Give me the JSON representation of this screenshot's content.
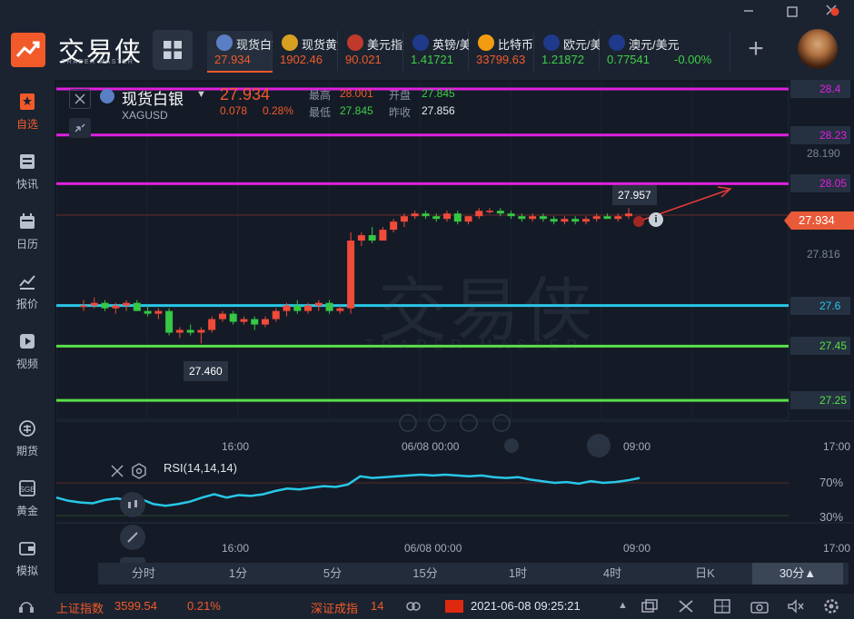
{
  "app": {
    "logo_text": "交易侠",
    "logo_sub": "TRADER MASTER"
  },
  "tickers": [
    {
      "name": "现货白银",
      "price": "27.934",
      "color": "#f25a2a",
      "icon": "silver-coin-icon",
      "icon_bg": "#5b7fc4"
    },
    {
      "name": "现货黄金",
      "price": "1902.46",
      "color": "#f25a2a",
      "icon": "gold-coin-icon",
      "icon_bg": "#d8a020"
    },
    {
      "name": "美元指数",
      "price": "90.021",
      "color": "#f25a2a",
      "icon": "us-flag-icon",
      "icon_bg": "#c0392b"
    },
    {
      "name": "英镑/美元",
      "price": "1.41721",
      "color": "#3ed048",
      "icon": "uk-flag-icon",
      "icon_bg": "#1f3a8a"
    },
    {
      "name": "比特币",
      "price": "33799.63",
      "color": "#f25a2a",
      "icon": "bitcoin-icon",
      "icon_bg": "#f39c12"
    },
    {
      "name": "欧元/美元",
      "price": "1.21872",
      "color": "#3ed048",
      "icon": "eu-flag-icon",
      "icon_bg": "#1f3a8a"
    },
    {
      "name": "澳元/美元",
      "price": "0.77541",
      "change": "-0.00%",
      "color": "#3ed048",
      "icon": "au-flag-icon",
      "icon_bg": "#1f3a8a"
    }
  ],
  "sidebar": [
    {
      "label": "自选",
      "icon": "bookmark-icon",
      "active": true
    },
    {
      "label": "快讯",
      "icon": "news-icon"
    },
    {
      "label": "日历",
      "icon": "calendar-icon"
    },
    {
      "label": "报价",
      "icon": "quote-chart-icon"
    },
    {
      "label": "视频",
      "icon": "video-play-icon"
    },
    {
      "label": "期货",
      "icon": "futures-icon"
    },
    {
      "label": "黄金",
      "icon": "sge-gold-icon"
    },
    {
      "label": "模拟",
      "icon": "simulate-wallet-icon"
    }
  ],
  "symbol": {
    "name": "现货白银",
    "code": "XAGUSD",
    "price": "27.934",
    "change": "0.078",
    "change_pct": "0.28%",
    "high_label": "最高",
    "high": "28.001",
    "open_label": "开盘",
    "open": "27.845",
    "low_label": "最低",
    "low": "27.845",
    "prev_label": "昨收",
    "prev": "27.856"
  },
  "watermark": {
    "text": "交易侠",
    "sub": "TRADER MASTER"
  },
  "levels": [
    {
      "value": 28.4,
      "label": "28.4",
      "color": "#e020e0"
    },
    {
      "value": 28.23,
      "label": "28.23",
      "color": "#e020e0"
    },
    {
      "value": 28.05,
      "label": "28.05",
      "color": "#e020e0"
    },
    {
      "value": 27.6,
      "label": "27.6",
      "color": "#28c8e8"
    },
    {
      "value": 27.45,
      "label": "27.45",
      "color": "#58e048"
    },
    {
      "value": 27.25,
      "label": "27.25",
      "color": "#58e048"
    }
  ],
  "axis_labels": {
    "p28190": "28.190",
    "p27816": "27.816",
    "current": "27.934",
    "hi_callout": "27.957",
    "lo_callout": "27.460"
  },
  "time_axis": {
    "t1": "16:00",
    "t2": "06/08 00:00",
    "t3": "09:00",
    "t4": "17:00"
  },
  "rsi": {
    "label": "RSI(14,14,14)",
    "upper": "70%",
    "lower": "30%"
  },
  "timeframes": [
    {
      "label": "分时"
    },
    {
      "label": "1分"
    },
    {
      "label": "5分"
    },
    {
      "label": "15分"
    },
    {
      "label": "1时"
    },
    {
      "label": "4时"
    },
    {
      "label": "日K"
    },
    {
      "label": "30分▲",
      "selected": true
    }
  ],
  "status": {
    "idx1_name": "上证指数",
    "idx1_value": "3599.54",
    "idx1_pct": "0.21%",
    "idx2_name": "深证成指",
    "idx2_value": "14",
    "datetime": "2021-06-08 09:25:21"
  },
  "chart_data": {
    "type": "candlestick",
    "interval": "30分",
    "ohlc": [
      [
        27.6,
        27.62,
        27.58,
        27.6
      ],
      [
        27.6,
        27.63,
        27.59,
        27.61
      ],
      [
        27.61,
        27.62,
        27.58,
        27.59
      ],
      [
        27.59,
        27.61,
        27.57,
        27.6
      ],
      [
        27.6,
        27.62,
        27.58,
        27.61
      ],
      [
        27.61,
        27.62,
        27.58,
        27.58
      ],
      [
        27.58,
        27.6,
        27.56,
        27.57
      ],
      [
        27.57,
        27.59,
        27.55,
        27.58
      ],
      [
        27.58,
        27.59,
        27.49,
        27.5
      ],
      [
        27.5,
        27.52,
        27.48,
        27.51
      ],
      [
        27.51,
        27.53,
        27.49,
        27.5
      ],
      [
        27.5,
        27.52,
        27.46,
        27.51
      ],
      [
        27.51,
        27.56,
        27.5,
        27.55
      ],
      [
        27.55,
        27.58,
        27.54,
        27.57
      ],
      [
        27.57,
        27.58,
        27.53,
        27.54
      ],
      [
        27.54,
        27.56,
        27.53,
        27.55
      ],
      [
        27.55,
        27.56,
        27.51,
        27.53
      ],
      [
        27.53,
        27.56,
        27.52,
        27.55
      ],
      [
        27.55,
        27.59,
        27.54,
        27.58
      ],
      [
        27.58,
        27.61,
        27.56,
        27.6
      ],
      [
        27.6,
        27.62,
        27.57,
        27.58
      ],
      [
        27.58,
        27.61,
        27.57,
        27.6
      ],
      [
        27.6,
        27.62,
        27.58,
        27.61
      ],
      [
        27.61,
        27.62,
        27.57,
        27.58
      ],
      [
        27.58,
        27.6,
        27.57,
        27.59
      ],
      [
        27.59,
        27.87,
        27.57,
        27.84
      ],
      [
        27.84,
        27.87,
        27.82,
        27.86
      ],
      [
        27.86,
        27.89,
        27.83,
        27.84
      ],
      [
        27.84,
        27.89,
        27.84,
        27.88
      ],
      [
        27.88,
        27.92,
        27.87,
        27.91
      ],
      [
        27.91,
        27.94,
        27.89,
        27.93
      ],
      [
        27.93,
        27.95,
        27.92,
        27.94
      ],
      [
        27.94,
        27.95,
        27.92,
        27.93
      ],
      [
        27.93,
        27.94,
        27.91,
        27.92
      ],
      [
        27.92,
        27.95,
        27.91,
        27.94
      ],
      [
        27.94,
        27.95,
        27.9,
        27.91
      ],
      [
        27.91,
        27.93,
        27.9,
        27.93
      ],
      [
        27.93,
        27.96,
        27.92,
        27.95
      ],
      [
        27.95,
        27.96,
        27.94,
        27.95
      ],
      [
        27.95,
        27.96,
        27.93,
        27.94
      ],
      [
        27.94,
        27.95,
        27.92,
        27.93
      ],
      [
        27.93,
        27.94,
        27.91,
        27.92
      ],
      [
        27.92,
        27.94,
        27.91,
        27.93
      ],
      [
        27.93,
        27.94,
        27.91,
        27.92
      ],
      [
        27.92,
        27.93,
        27.9,
        27.91
      ],
      [
        27.91,
        27.93,
        27.9,
        27.92
      ],
      [
        27.92,
        27.93,
        27.9,
        27.91
      ],
      [
        27.91,
        27.93,
        27.9,
        27.92
      ],
      [
        27.92,
        27.94,
        27.91,
        27.93
      ],
      [
        27.93,
        27.94,
        27.92,
        27.92
      ],
      [
        27.92,
        27.94,
        27.91,
        27.93
      ],
      [
        27.93,
        27.96,
        27.92,
        27.94
      ]
    ],
    "rsi": [
      52,
      48,
      46,
      45,
      49,
      51,
      48,
      50,
      44,
      42,
      44,
      47,
      52,
      56,
      52,
      55,
      54,
      56,
      60,
      63,
      62,
      64,
      66,
      65,
      68,
      78,
      76,
      77,
      78,
      79,
      80,
      79,
      80,
      79,
      78,
      79,
      77,
      76,
      77,
      74,
      72,
      70,
      71,
      69,
      72,
      70,
      71,
      73,
      76
    ],
    "y_range": [
      27.18,
      28.42
    ],
    "rsi_range": [
      0,
      100
    ]
  }
}
